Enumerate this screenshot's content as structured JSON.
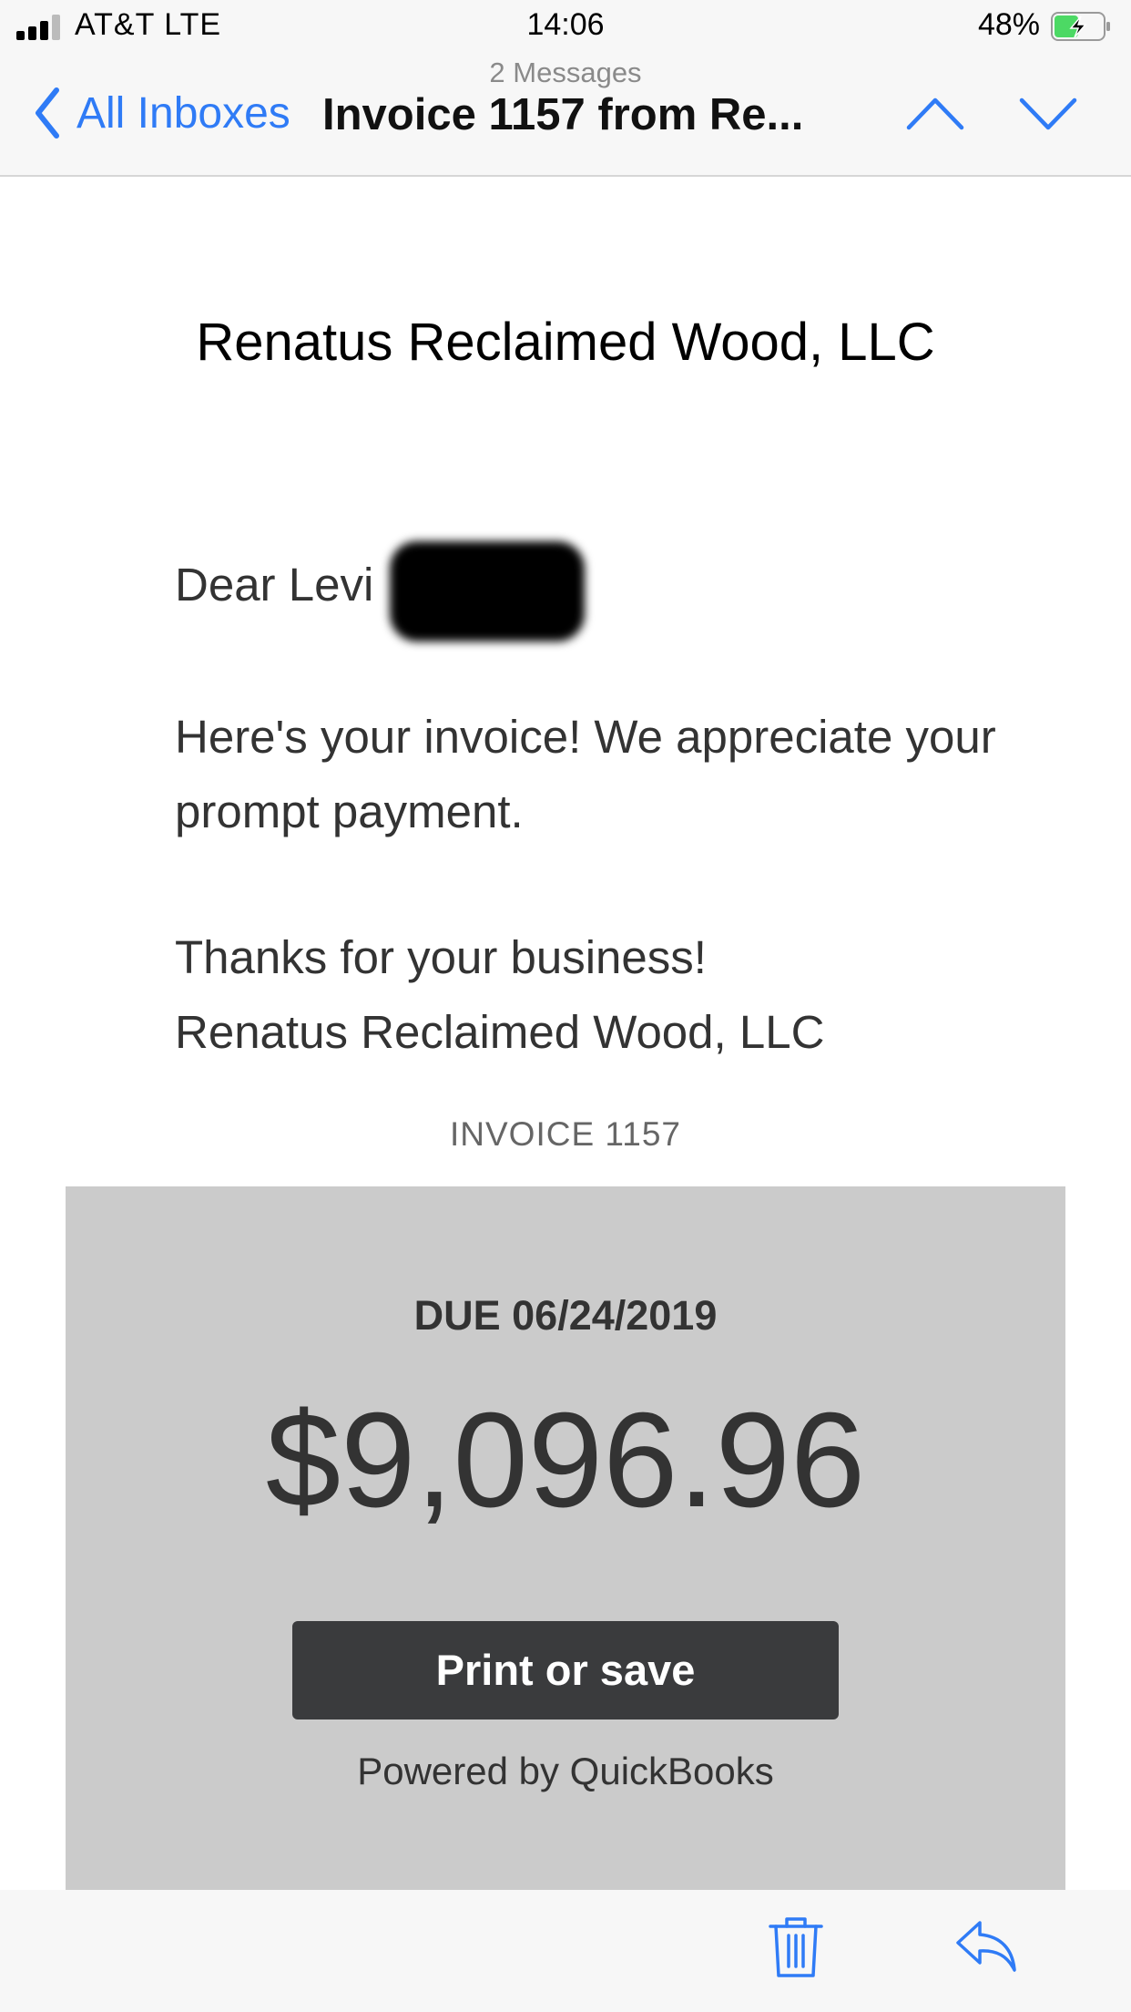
{
  "status_bar": {
    "carrier": "AT&T LTE",
    "time": "14:06",
    "battery_percent": "48%",
    "battery_level": 0.48,
    "battery_charging": true
  },
  "nav": {
    "message_count": "2 Messages",
    "back_label": "All Inboxes",
    "subject": "Invoice 1157 from Re...",
    "icons": [
      "chevron-left-icon",
      "chevron-up-icon",
      "chevron-down-icon"
    ],
    "accent_color": "#2f7bf6"
  },
  "email": {
    "company": "Renatus Reclaimed Wood, LLC",
    "greeting": "Dear Levi",
    "greeting_suffix": ",",
    "body_lines": [
      "Here's your invoice! We appreciate your prompt payment."
    ],
    "signoff": "Thanks for your business!",
    "signature": "Renatus Reclaimed Wood, LLC",
    "invoice_label": "INVOICE 1157",
    "due": "DUE 06/24/2019",
    "amount": "$9,096.96",
    "print_button": "Print or save",
    "powered_by": "Powered by QuickBooks"
  },
  "toolbar": {
    "icons": [
      "trash-icon",
      "reply-icon"
    ]
  }
}
